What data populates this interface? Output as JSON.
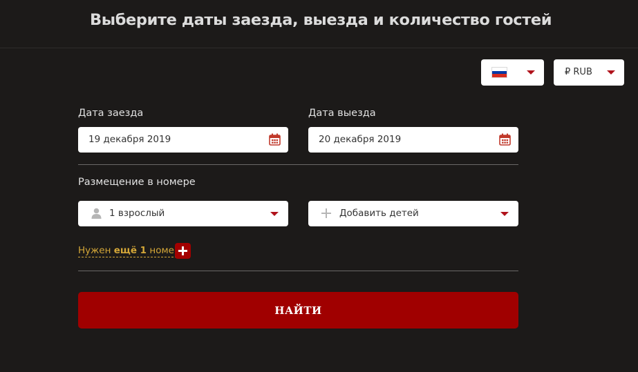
{
  "header": {
    "title": "Выберите даты заезда, выезда и количество гостей"
  },
  "language_select": {
    "icon": "russia-flag-icon",
    "flag_colors": [
      "#ffffff",
      "#0039a6",
      "#d52b1e"
    ]
  },
  "currency_select": {
    "value": "₽ RUB"
  },
  "checkin": {
    "label": "Дата заезда",
    "value": "19 декабря 2019"
  },
  "checkout": {
    "label": "Дата выезда",
    "value": "20 декабря 2019"
  },
  "accommodation": {
    "label": "Размещение в номере",
    "adults_value": "1 взрослый",
    "children_value": "Добавить детей"
  },
  "more_room": {
    "prefix": "Нужен ",
    "bold": "ещё 1",
    "suffix": " номер"
  },
  "search_button": {
    "label": "НАЙТИ"
  },
  "colors": {
    "accent": "#a00000",
    "link": "#d4a738",
    "background": "#1c1a19"
  }
}
